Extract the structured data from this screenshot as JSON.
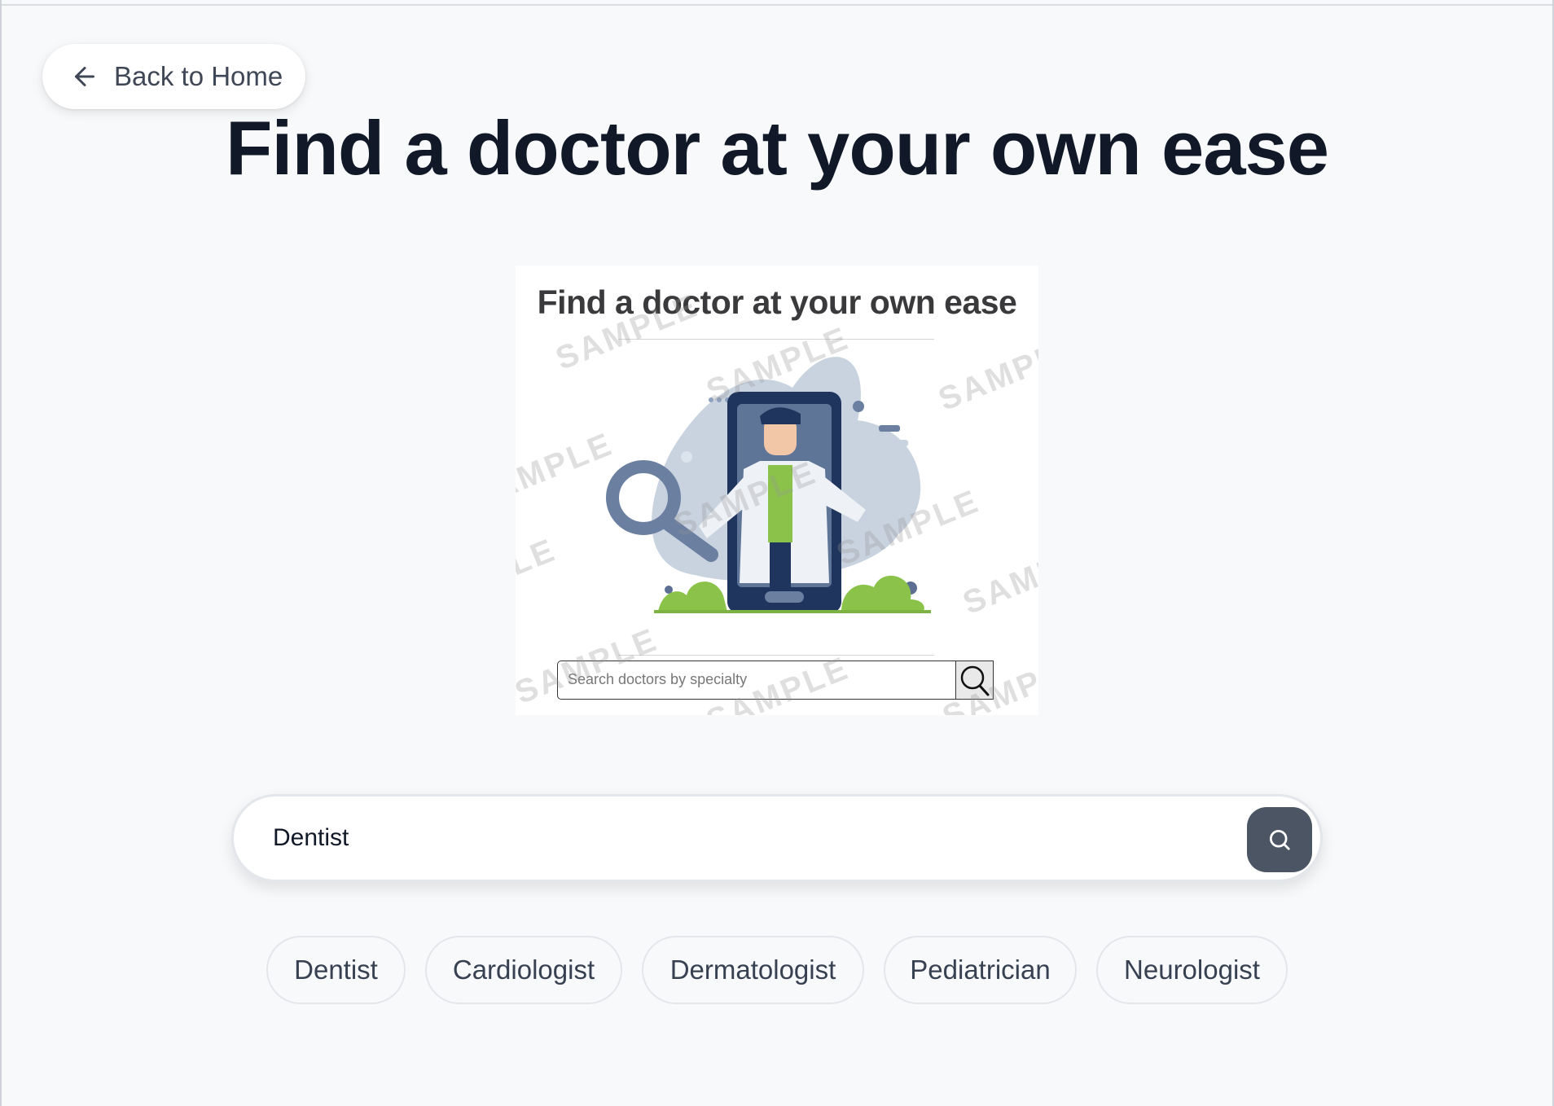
{
  "nav": {
    "back_label": "Back to Home"
  },
  "page": {
    "title": "Find a doctor at your own ease"
  },
  "illustration": {
    "title": "Find a doctor at your own ease",
    "search_placeholder": "Search doctors by specialty",
    "watermark": "SAMPLE"
  },
  "search": {
    "value": "Dentist",
    "button_icon": "search-icon"
  },
  "specialties": [
    "Dentist",
    "Cardiologist",
    "Dermatologist",
    "Pediatrician",
    "Neurologist"
  ],
  "colors": {
    "background": "#f8f9fb",
    "title": "#111827",
    "search_button": "#4b5563",
    "accent_green": "#8bc34a",
    "illustration_navy": "#1f355e"
  }
}
